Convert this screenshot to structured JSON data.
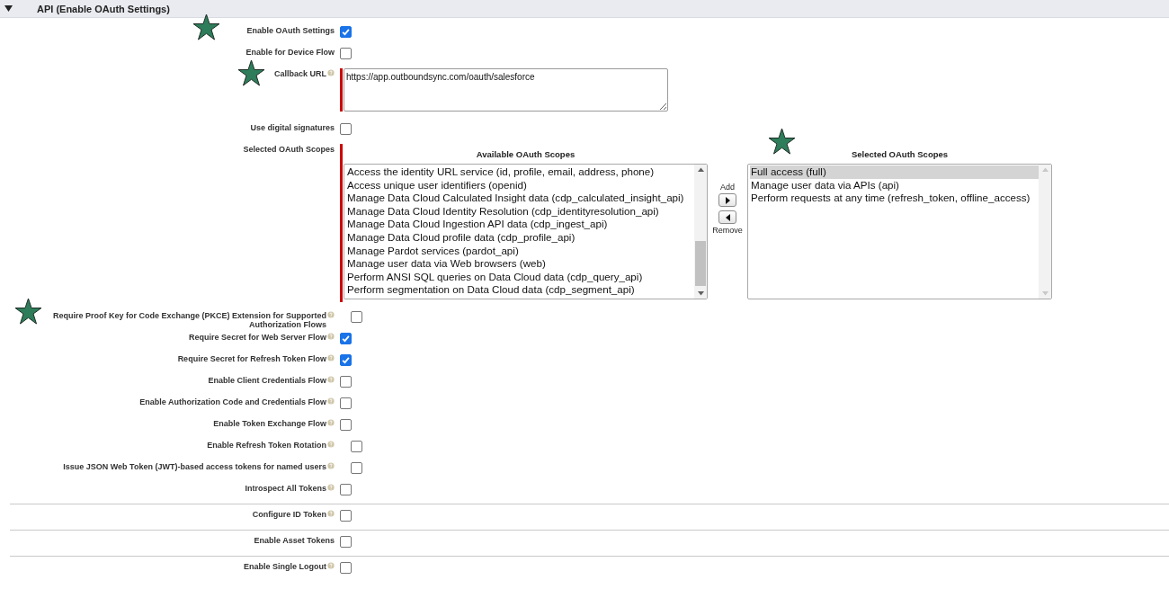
{
  "section": {
    "title": "API (Enable OAuth Settings)",
    "expanded": true
  },
  "fields": [
    {
      "kind": "checkbox",
      "label": "Enable OAuth Settings",
      "checked": true,
      "help": false,
      "divider_above": false
    },
    {
      "kind": "checkbox",
      "label": "Enable for Device Flow",
      "checked": false,
      "help": false,
      "divider_above": false
    },
    {
      "kind": "textarea",
      "label": "Callback URL",
      "value": "https://app.outboundsync.com/oauth/salesforce",
      "help": true,
      "required": true,
      "divider_above": false
    },
    {
      "kind": "checkbox",
      "label": "Use digital signatures",
      "checked": false,
      "help": false,
      "divider_above": false
    },
    {
      "kind": "scopes",
      "label": "Selected OAuth Scopes",
      "required": true,
      "help": false,
      "divider_above": false,
      "available": {
        "title": "Available OAuth Scopes",
        "items": [
          {
            "label": "Access the identity URL service (id, profile, email, address, phone)",
            "selected": false
          },
          {
            "label": "Access unique user identifiers (openid)",
            "selected": false
          },
          {
            "label": "Manage Data Cloud Calculated Insight data (cdp_calculated_insight_api)",
            "selected": false
          },
          {
            "label": "Manage Data Cloud Identity Resolution (cdp_identityresolution_api)",
            "selected": false
          },
          {
            "label": "Manage Data Cloud Ingestion API data (cdp_ingest_api)",
            "selected": false
          },
          {
            "label": "Manage Data Cloud profile data (cdp_profile_api)",
            "selected": false
          },
          {
            "label": "Manage Pardot services (pardot_api)",
            "selected": false
          },
          {
            "label": "Manage user data via Web browsers (web)",
            "selected": false
          },
          {
            "label": "Perform ANSI SQL queries on Data Cloud data (cdp_query_api)",
            "selected": false
          },
          {
            "label": "Perform segmentation on Data Cloud data (cdp_segment_api)",
            "selected": false
          }
        ]
      },
      "add_label": "Add",
      "remove_label": "Remove",
      "selected": {
        "title": "Selected OAuth Scopes",
        "items": [
          {
            "label": "Full access (full)",
            "selected": true
          },
          {
            "label": "Manage user data via APIs (api)",
            "selected": false
          },
          {
            "label": "Perform requests at any time (refresh_token, offline_access)",
            "selected": false
          }
        ]
      }
    },
    {
      "kind": "checkbox",
      "label": "Require Proof Key for Code Exchange (PKCE) Extension for Supported Authorization Flows",
      "checked": false,
      "help": true,
      "divider_above": false
    },
    {
      "kind": "checkbox",
      "label": "Require Secret for Web Server Flow",
      "checked": true,
      "help": true,
      "divider_above": false
    },
    {
      "kind": "checkbox",
      "label": "Require Secret for Refresh Token Flow",
      "checked": true,
      "help": true,
      "divider_above": false
    },
    {
      "kind": "checkbox",
      "label": "Enable Client Credentials Flow",
      "checked": false,
      "help": true,
      "divider_above": false
    },
    {
      "kind": "checkbox",
      "label": "Enable Authorization Code and Credentials Flow",
      "checked": false,
      "help": true,
      "divider_above": false
    },
    {
      "kind": "checkbox",
      "label": "Enable Token Exchange Flow",
      "checked": false,
      "help": true,
      "divider_above": false
    },
    {
      "kind": "checkbox",
      "label": "Enable Refresh Token Rotation",
      "checked": false,
      "help": true,
      "divider_above": false
    },
    {
      "kind": "checkbox",
      "label": "Issue JSON Web Token (JWT)-based access tokens for named users",
      "checked": false,
      "help": true,
      "divider_above": false
    },
    {
      "kind": "checkbox",
      "label": "Introspect All Tokens",
      "checked": false,
      "help": true,
      "divider_above": false
    },
    {
      "kind": "checkbox",
      "label": "Configure ID Token",
      "checked": false,
      "help": true,
      "divider_above": true
    },
    {
      "kind": "checkbox",
      "label": "Enable Asset Tokens",
      "checked": false,
      "help": false,
      "divider_above": true
    },
    {
      "kind": "checkbox",
      "label": "Enable Single Logout",
      "checked": false,
      "help": true,
      "divider_above": true
    }
  ]
}
